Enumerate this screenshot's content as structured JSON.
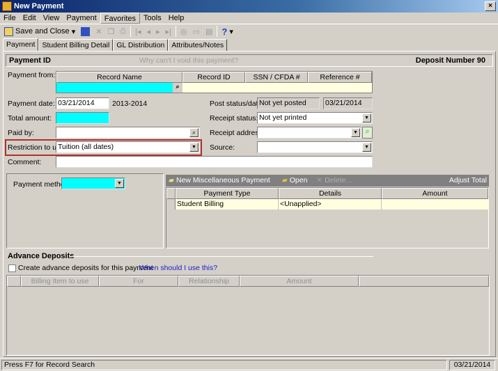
{
  "window": {
    "title": "New Payment",
    "close": "×"
  },
  "menu": [
    "File",
    "Edit",
    "View",
    "Payment",
    "Favorites",
    "Tools",
    "Help"
  ],
  "toolbar": {
    "save_close": "Save and Close",
    "help": "?"
  },
  "tabs": [
    "Payment",
    "Student Billing Detail",
    "GL Distribution",
    "Attributes/Notes"
  ],
  "header": {
    "payment_id": "Payment ID",
    "void_link": "Why can't I void this payment?",
    "deposit": "Deposit Number 90"
  },
  "payment_from": {
    "label": "Payment from:",
    "columns": [
      "Record Name",
      "Record ID",
      "SSN / CFDA #",
      "Reference #"
    ]
  },
  "form": {
    "payment_date_label": "Payment date:",
    "payment_date": "03/21/2014",
    "fiscal_year": "2013-2014",
    "total_amount_label": "Total amount:",
    "paid_by_label": "Paid by:",
    "restriction_label": "Restriction to use:",
    "restriction": "Tuition (all dates)",
    "comment_label": "Comment:",
    "post_status_label": "Post status/date:",
    "post_status": "Not yet posted",
    "post_date": "03/21/2014",
    "receipt_status_label": "Receipt status:",
    "receipt_status": "Not yet printed",
    "receipt_address_label": "Receipt address:",
    "source_label": "Source:",
    "payment_method_label": "Payment method:"
  },
  "grid": {
    "new_misc": "New Miscellaneous Payment",
    "open": "Open",
    "delete": "Delete...",
    "adjust": "Adjust Total",
    "columns": [
      "Payment Type",
      "Details",
      "Amount"
    ],
    "rows": [
      {
        "type": "Student Billing",
        "details": "<Unapplied>",
        "amount": ""
      }
    ]
  },
  "advance": {
    "title": "Advance Deposits",
    "checkbox": "Create advance deposits for this payment",
    "link": "When should I use this?",
    "columns": [
      "Billing Item to use",
      "For",
      "Relationship",
      "Amount"
    ]
  },
  "status": {
    "hint": "Press F7 for Record Search",
    "date": "03/21/2014"
  }
}
